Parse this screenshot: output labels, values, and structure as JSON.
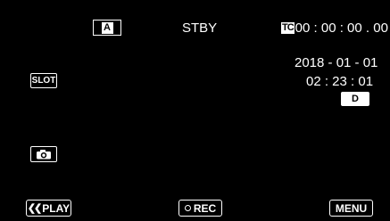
{
  "top_bar": {
    "auto_mode_label": "A",
    "status": "STBY",
    "timecode_badge": "TC",
    "timecode": "00 : 00 : 00 . 00"
  },
  "info": {
    "date": "2018 - 01 - 01",
    "time": "02 : 23 : 01",
    "date_style_button": "D"
  },
  "left_controls": {
    "slot_label": "SLOT",
    "camera_icon": "camera-icon"
  },
  "bottom_bar": {
    "play_label": "PLAY",
    "play_icon": "double-chevron-left-icon",
    "rec_label": "REC",
    "rec_icon": "circle-outline-icon",
    "menu_label": "MENU"
  },
  "colors": {
    "background": "#000000",
    "foreground": "#ffffff"
  }
}
